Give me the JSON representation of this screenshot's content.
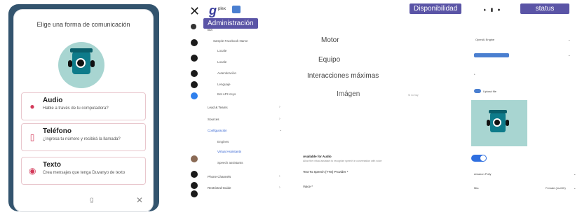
{
  "widget": {
    "title": "Elige una forma de comunicación",
    "options": [
      {
        "title": "Audio",
        "description": "Hable a través de tu computadora?",
        "icon": "microphone-icon"
      },
      {
        "title": "Teléfono",
        "description": "¿Ingresa tu número y recibirá la llamada?",
        "icon": "phone-icon"
      },
      {
        "title": "Texto",
        "description": "Crea mensajes que tenga Duvanyo de texto",
        "icon": "chat-icon"
      }
    ],
    "footer_logo": "g",
    "close_icon": "close-icon"
  },
  "header": {
    "logo_letter": "g",
    "logo_text": "plex"
  },
  "callouts": {
    "admin": "Administración",
    "availability": "Disponibilidad",
    "status": "status"
  },
  "sidebar": {
    "items": [
      {
        "label": "Bot",
        "type": "header"
      },
      {
        "label": "Sample Facebook Name",
        "type": "sub"
      },
      {
        "label": "Locale",
        "type": "sub2"
      },
      {
        "label": "Locale",
        "type": "sub2"
      },
      {
        "label": "Autenticación",
        "type": "sub2"
      },
      {
        "label": "Lenguaje",
        "type": "sub2"
      },
      {
        "label": "Bot API Keys",
        "type": "sub2"
      },
      {
        "label": "Lead & Teams",
        "type": "header"
      },
      {
        "label": "Sources",
        "type": "header"
      },
      {
        "label": "Configuración",
        "type": "accent"
      },
      {
        "label": "Engines",
        "type": "sub2"
      },
      {
        "label": "Virtual Assistants",
        "type": "sub2accent"
      },
      {
        "label": "Speech assistants",
        "type": "sub2"
      },
      {
        "label": "Phone Channels",
        "type": "header"
      },
      {
        "label": "Restricted Guide",
        "type": "header"
      }
    ]
  },
  "floating_labels": {
    "motor": "Motor",
    "equipo": "Equipo",
    "interacciones": "Interacciones máximas",
    "imagen": "Imágen",
    "imagen_note": "Si no hay"
  },
  "form": {
    "available_label": "Available for Audio",
    "available_help": "Allow the virtual assistant to recognize speech in conversation with voice",
    "tts_label": "Text To Speech (TTS) Provider *",
    "voice_label": "Voice *"
  },
  "right_panel": {
    "engine_value": "OpenAI Engine",
    "cloud_label": "Upload file",
    "tts_value": "Amazon Polly",
    "voice_value": "Mia",
    "voice_extra": "Female (es-MX)",
    "asterisk": "*"
  },
  "colors": {
    "callout": "#5a54a6",
    "accent": "#2f6fe0",
    "bot_bg": "#a8d5d1",
    "widget_frame": "#33546e"
  }
}
